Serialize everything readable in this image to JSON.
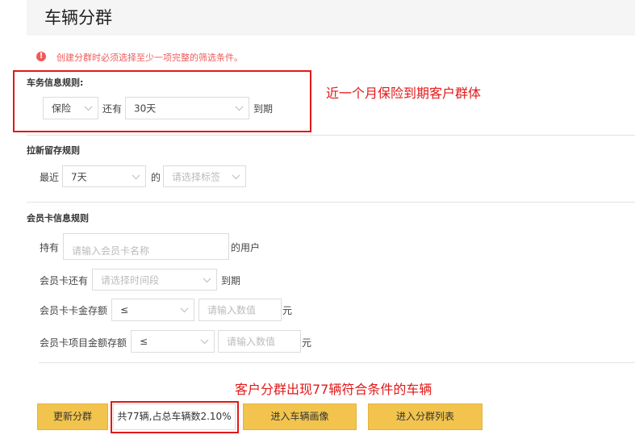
{
  "page": {
    "title": "车辆分群"
  },
  "warning": {
    "icon": "alert-circle-icon",
    "text": "创建分群时必须选择至少一项完整的筛选条件。"
  },
  "vehicle_rule": {
    "title": "车务信息规则:",
    "type_value": "保险",
    "still_label": "还有",
    "days_value": "30天",
    "expire_label": "到期",
    "annotation": "近一个月保险到期客户群体"
  },
  "retention_rule": {
    "title": "拉新留存规则",
    "recent_label": "最近",
    "period_value": "7天",
    "of_label": "的",
    "tag_placeholder": "请选择标签"
  },
  "card_rule": {
    "title": "会员卡信息规则",
    "hold_label": "持有",
    "card_name_placeholder": "请输入会员卡名称",
    "users_label": "的用户",
    "remaining_label": "会员卡还有",
    "time_placeholder": "请选择时间段",
    "expire_label": "到期",
    "balance_label": "会员卡卡金存额",
    "balance_op": "≤",
    "balance_placeholder": "请输入数值",
    "balance_unit": "元",
    "item_label": "会员卡项目金额存额",
    "item_op": "≤",
    "item_placeholder": "请输入数值",
    "item_unit": "元"
  },
  "result_annotation": "客户分群出现77辆符合条件的车辆",
  "actions": {
    "update": "更新分群",
    "stat": "共77辆,占总车辆数2.10%",
    "portrait": "进入车辆画像",
    "list": "进入分群列表"
  },
  "colors": {
    "accent": "#f2c44d",
    "annotation": "#e21818",
    "warning": "#f15a5a"
  }
}
